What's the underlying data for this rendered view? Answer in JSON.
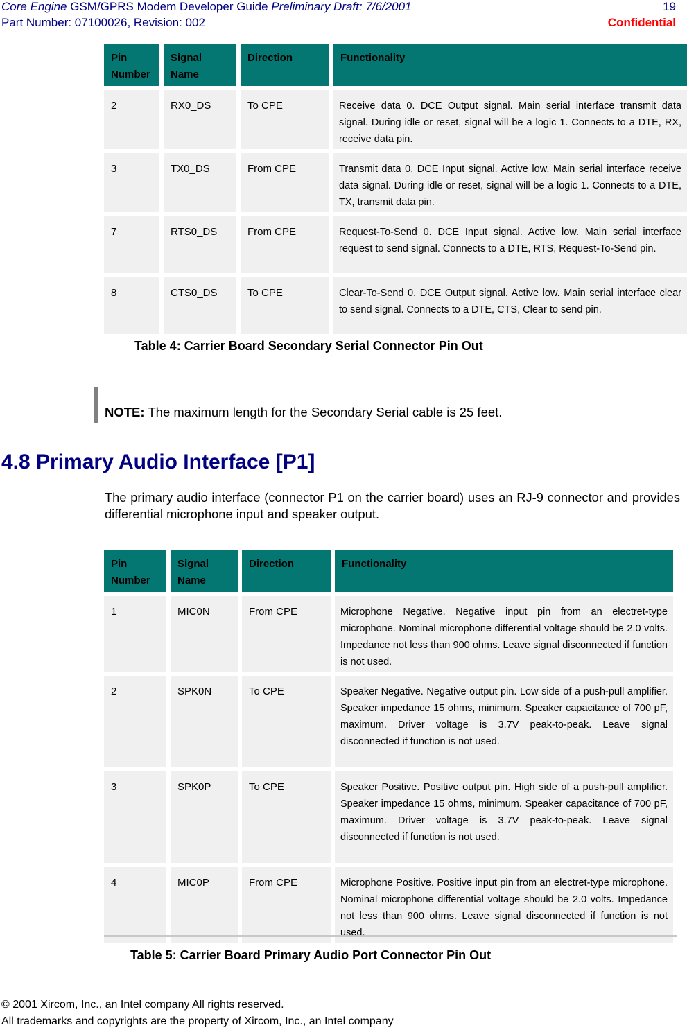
{
  "header": {
    "doc_title_italic": "Core Engine",
    "doc_title": " GSM/GPRS Modem Developer Guide ",
    "draft_italic": "Preliminary Draft: 7/6/2001",
    "part_number": "Part Number: 07100026, Revision: 002",
    "page_number": "19",
    "confidential": "Confidential"
  },
  "colors": {
    "header_text": "#000080",
    "confidential": "#ff0000",
    "table_header_bg": "#057773",
    "table_cell_bg": "#f0f0f0"
  },
  "table4": {
    "columns": [
      "Pin Number",
      "Signal Name",
      "Direction",
      "Functionality"
    ],
    "col_pin_line1": "Pin",
    "col_pin_line2": "Number",
    "col_signal_line1": "Signal",
    "col_signal_line2": "Name",
    "rows": [
      {
        "pin": "2",
        "signal": "RX0_DS",
        "direction": "To CPE",
        "function": "Receive data 0. DCE Output signal. Main serial interface transmit data signal. During idle or reset, signal will be a logic 1. Connects to a DTE, RX, receive data pin."
      },
      {
        "pin": "3",
        "signal": "TX0_DS",
        "direction": "From CPE",
        "function": "Transmit data 0. DCE Input signal. Active low. Main serial interface receive data signal. During idle or reset, signal will be a logic 1. Connects to a DTE, TX, transmit data pin."
      },
      {
        "pin": "7",
        "signal": "RTS0_DS",
        "direction": "From CPE",
        "function": "Request-To-Send 0. DCE Input signal. Active low. Main serial interface request to send signal. Connects to a DTE, RTS, Request-To-Send pin."
      },
      {
        "pin": "8",
        "signal": "CTS0_DS",
        "direction": "To CPE",
        "function": "Clear-To-Send 0. DCE Output signal. Active low. Main serial interface clear to send signal. Connects to a DTE, CTS, Clear to send pin."
      }
    ],
    "caption": "Table 4: Carrier Board Secondary Serial Connector Pin Out"
  },
  "note": {
    "label": "NOTE:",
    "text": " The maximum length for the Secondary Serial cable is 25 feet."
  },
  "section": {
    "heading": "4.8 Primary Audio Interface [P1]",
    "paragraph": "The primary audio interface (connector P1 on the carrier board) uses an RJ-9 connector and provides differential microphone input and speaker output."
  },
  "table5": {
    "columns": [
      "Pin Number",
      "Signal Name",
      "Direction",
      "Functionality"
    ],
    "col_pin_line1": "Pin",
    "col_pin_line2": "Number",
    "col_signal_line1": "Signal",
    "col_signal_line2": "Name",
    "rows": [
      {
        "pin": "1",
        "signal": "MIC0N",
        "direction": "From CPE",
        "function": "Microphone Negative. Negative input pin from an electret-type microphone. Nominal microphone differential voltage should be 2.0 volts. Impedance not less than 900 ohms. Leave signal disconnected if function is not used."
      },
      {
        "pin": "2",
        "signal": "SPK0N",
        "direction": "To CPE",
        "function": "Speaker Negative. Negative output pin. Low side of a push-pull amplifier. Speaker impedance 15 ohms, minimum. Speaker capacitance of 700 pF, maximum. Driver voltage is 3.7V peak-to-peak. Leave signal disconnected if function is not used."
      },
      {
        "pin": "3",
        "signal": "SPK0P",
        "direction": "To CPE",
        "function": "Speaker Positive. Positive output pin. High side of a push-pull amplifier. Speaker impedance 15 ohms, minimum. Speaker capacitance of 700 pF, maximum. Driver voltage is 3.7V peak-to-peak. Leave signal disconnected if function is not used."
      },
      {
        "pin": "4",
        "signal": "MIC0P",
        "direction": "From CPE",
        "function": "Microphone Positive. Positive input pin from an electret-type microphone. Nominal microphone differential voltage should be 2.0 volts. Impedance not less than 900 ohms. Leave signal disconnected if function is not used."
      }
    ],
    "caption": "Table 5: Carrier Board Primary Audio Port Connector Pin Out"
  },
  "footer": {
    "copyright": "© 2001 Xircom, Inc., an Intel company All rights reserved.",
    "trademarks": "All trademarks and copyrights are the property of Xircom, Inc., an Intel company"
  }
}
